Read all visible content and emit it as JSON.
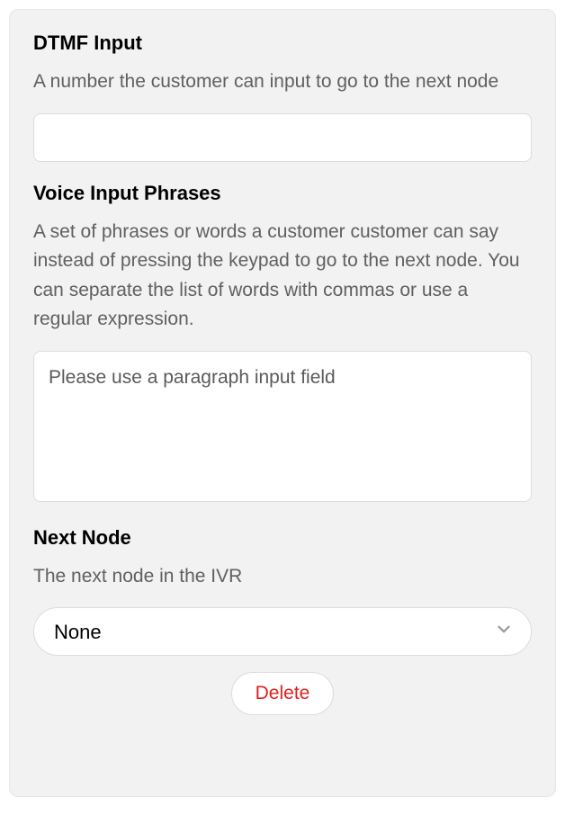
{
  "dtmf": {
    "title": "DTMF Input",
    "desc": "A number the customer can input to go to the next node",
    "value": ""
  },
  "voice": {
    "title": "Voice Input Phrases",
    "desc": "A set of phrases or words a customer customer can say instead of pressing the keypad to go to the next node. You can separate the list of words with commas or use a regular expression.",
    "placeholder": "Please use a paragraph input field",
    "value": ""
  },
  "nextNode": {
    "title": "Next Node",
    "desc": "The next node in the IVR",
    "selected": "None"
  },
  "actions": {
    "delete": "Delete"
  }
}
